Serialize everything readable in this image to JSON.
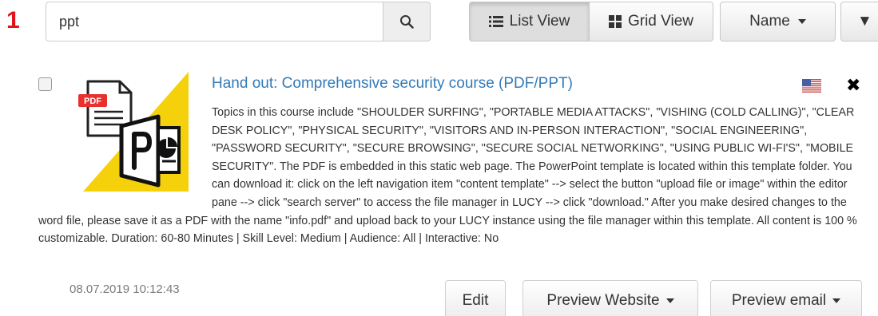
{
  "step": {
    "number": "1"
  },
  "search": {
    "value": "ppt",
    "placeholder": ""
  },
  "toolbar": {
    "list_view_label": "List View",
    "grid_view_label": "Grid View",
    "sort_label": "Name",
    "more_label": "▼",
    "active_view": "list"
  },
  "item": {
    "title": "Hand out: Comprehensive security course (PDF/PPT)",
    "thumbnail_badge": "PDF",
    "description": "Topics in this course include \"SHOULDER SURFING\", \"PORTABLE MEDIA ATTACKS\", \"VISHING (COLD CALLING)\", \"CLEAR DESK POLICY\", \"PHYSICAL SECURITY\", \"VISITORS AND IN-PERSON INTERACTION\", \"SOCIAL ENGINEERING\", \"PASSWORD SECURITY\", \"SECURE BROWSING\", \"SECURE SOCIAL NETWORKING\", \"USING PUBLIC WI-FI'S\", \"MOBILE SECURITY\". The PDF is embedded in this static web page. The PowerPoint template is located within this template folder. You can download it: click on the left navigation item \"content template\" --> select the button \"upload file or image\" within the editor pane --> click \"search server\" to access the file manager in LUCY --> click \"download.\" After you make desired changes to the word file, please save it as a PDF with the name \"info.pdf\" and upload back to your LUCY instance using the file manager within this template. All content is 100 % customizable. Duration: 60-80 Minutes | Skill Level: Medium | Audience: All | Interactive: No",
    "date": "08.07.2019 10:12:43",
    "language_icon": "us-flag-icon",
    "checked": false
  },
  "actions": {
    "edit_label": "Edit",
    "preview_website_label": "Preview Website",
    "preview_email_label": "Preview email"
  },
  "colors": {
    "step_number": "#e0141b",
    "title_link": "#337ab7",
    "thumbnail_triangle": "#f5d10c",
    "pdf_badge": "#e8302c"
  }
}
